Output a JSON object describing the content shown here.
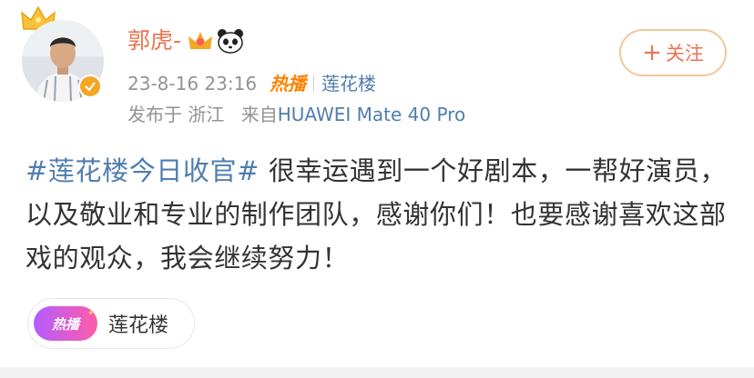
{
  "author": {
    "name": "郭虎-",
    "badges": [
      "crown-icon",
      "panda-icon"
    ],
    "verified": true
  },
  "post_meta": {
    "datetime": "23-8-16 23:16",
    "hot_tag": "热播",
    "topic": "莲花楼",
    "location": "发布于 浙江",
    "source_prefix": "来自",
    "device": "HUAWEI Mate 40 Pro"
  },
  "follow_button": {
    "label": "关注",
    "icon": "plus-icon"
  },
  "post": {
    "hashtag": "#莲花楼今日收官#",
    "body": " 很幸运遇到一个好剧本，一帮好演员，以及敬业和专业的制作团队，感谢你们！也要感谢喜欢这部戏的观众，我会继续努力！"
  },
  "topic_card": {
    "badge": "热播",
    "title": "莲花楼"
  },
  "colors": {
    "name": "#eb7350",
    "link": "#507daf",
    "meta": "#939393",
    "hot": "#ff8200",
    "verified": "#f5a623"
  }
}
